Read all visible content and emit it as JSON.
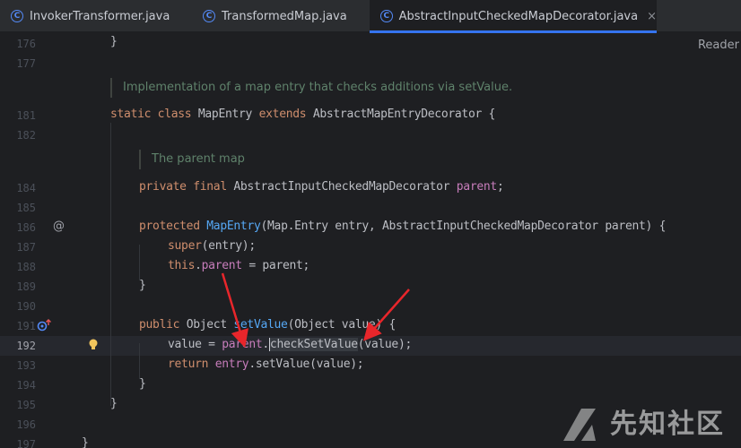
{
  "tabs": [
    {
      "label": "InvokerTransformer.java",
      "active": false
    },
    {
      "label": "TransformedMap.java",
      "active": false
    },
    {
      "label": "AbstractInputCheckedMapDecorator.java",
      "active": true,
      "close": "×"
    }
  ],
  "editor": {
    "reader_mode_label": "Reader",
    "current_line": "192",
    "lines": {
      "l176": "176",
      "l177": "177",
      "l181": "181",
      "l182": "182",
      "l184": "184",
      "l185": "185",
      "l186": "186",
      "l187": "187",
      "l188": "188",
      "l189": "189",
      "l190": "190",
      "l191": "191",
      "l192": "192",
      "l193": "193",
      "l194": "194",
      "l195": "195",
      "l196": "196",
      "l197": "197"
    },
    "docs": {
      "mapentry": "Implementation of a map entry that checks additions via setValue.",
      "parent": "The parent map"
    },
    "code": {
      "c176": "}",
      "c181_kw": "static class ",
      "c181_a": "MapEntry ",
      "c181_kw2": "extends ",
      "c181_b": "AbstractMapEntryDecorator {",
      "c184_kw": "private final ",
      "c184_a": "AbstractInputCheckedMapDecorator ",
      "c184_f": "parent",
      "c184_b": ";",
      "c186_kw": "protected ",
      "c186_fn": "MapEntry",
      "c186_a": "(Map.Entry entry, AbstractInputCheckedMapDecorator parent) {",
      "c187_kw": "super",
      "c187_a": "(entry);",
      "c188_kw": "this",
      "c188_a": ".",
      "c188_f": "parent",
      "c188_b": " = parent;",
      "c189": "}",
      "c191_kw": "public ",
      "c191_a": "Object ",
      "c191_fn": "setValue",
      "c191_b": "(Object value) {",
      "c192_a": "value = ",
      "c192_f": "parent",
      "c192_b": ".",
      "c192_fn": "checkSetValue",
      "c192_c": "(value);",
      "c193_kw": "return ",
      "c193_f": "entry",
      "c193_a": ".setValue(value);",
      "c194": "}",
      "c195": "}",
      "c197": "}"
    },
    "gutter_icons": {
      "line186": "@",
      "line191": "override-icon"
    }
  },
  "watermark": {
    "text": "先知社区"
  },
  "colors": {
    "background": "#1e1f22",
    "tabbar": "#2b2d30",
    "accent": "#3574f0",
    "keyword": "#cf8e6d",
    "field": "#c77dbb",
    "function": "#56a8f5",
    "doc_comment": "#5f826b",
    "annotation_arrow": "#e8262b"
  }
}
